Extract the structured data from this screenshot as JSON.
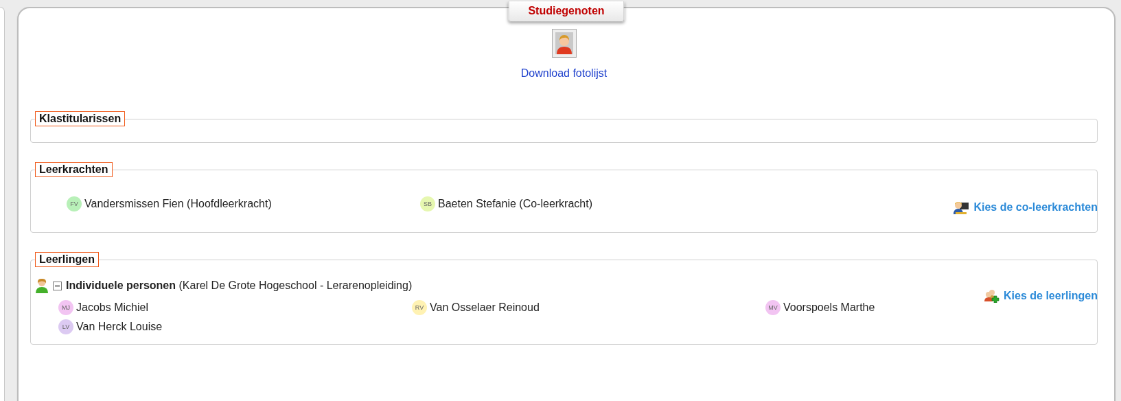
{
  "tab": {
    "label": "Studiegenoten"
  },
  "download": {
    "label": "Download fotolijst"
  },
  "sections": [
    {
      "title": "Klastitularissen"
    },
    {
      "title": "Leerkrachten",
      "action": "Kies de co-leerkrachten",
      "kind": "teacher",
      "persons": [
        {
          "initials": "FV",
          "name": "Vandersmissen Fien (Hoofdleerkracht)",
          "color": "#b8f0b8"
        },
        {
          "initials": "SB",
          "name": "Baeten Stefanie (Co-leerkracht)",
          "color": "#e6f7b0"
        }
      ]
    },
    {
      "title": "Leerlingen",
      "action": "Kies de leerlingen",
      "kind": "students",
      "group": {
        "label": "**Individuele personen** (Karel De Grote Hogeschool - Lerarenopleiding)",
        "expanded": true
      },
      "persons": [
        {
          "initials": "MJ",
          "name": "Jacobs Michiel",
          "color": "#f2c4f2"
        },
        {
          "initials": "RV",
          "name": "Van Osselaer Reinoud",
          "color": "#fff2b3"
        },
        {
          "initials": "MV",
          "name": "Voorspoels Marthe",
          "color": "#f2c4f2"
        },
        {
          "initials": "LV",
          "name": "Van Herck Louise",
          "color": "#dccaf2"
        }
      ]
    }
  ]
}
